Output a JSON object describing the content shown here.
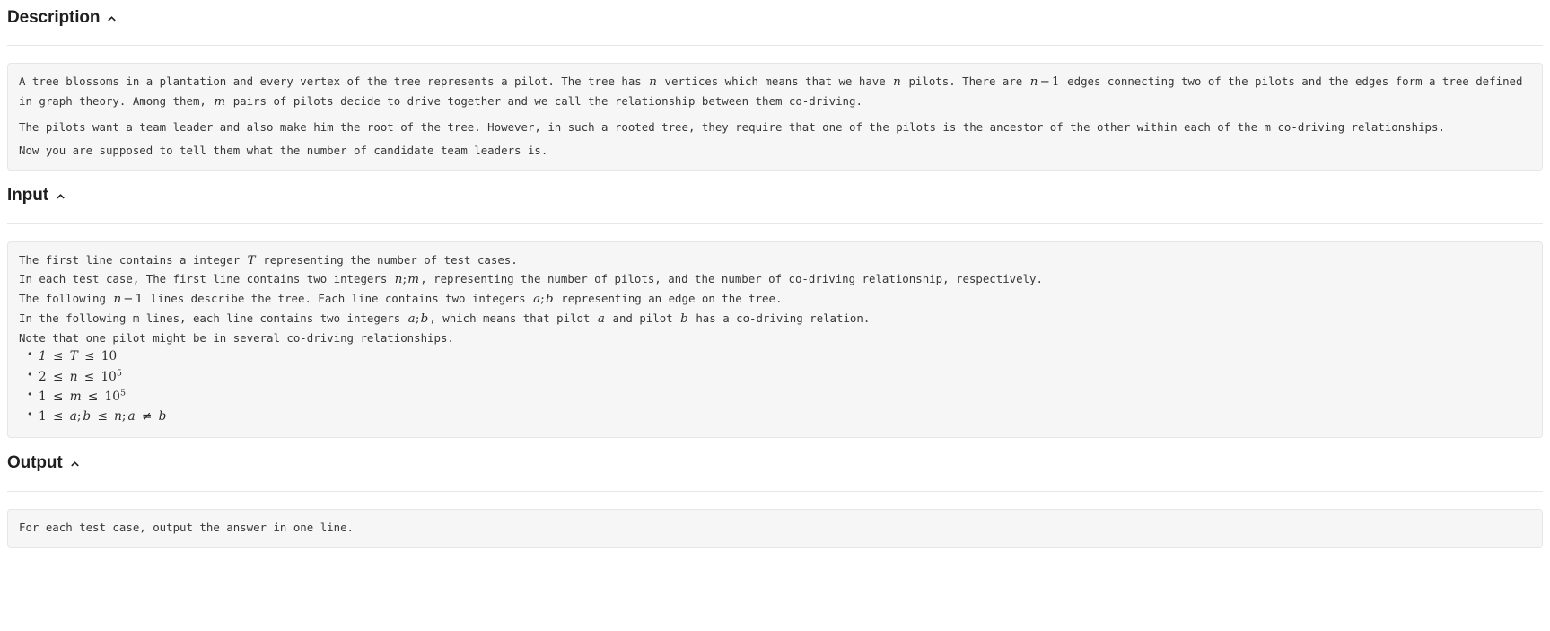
{
  "sections": {
    "description": {
      "title": "Description",
      "toggle_icon": "chevron-up-icon",
      "paragraphs": [
        {
          "runs": [
            {
              "t": "text",
              "v": "A tree blossoms in a plantation and every vertex of the tree represents a pilot. The tree has "
            },
            {
              "t": "math",
              "v": "n"
            },
            {
              "t": "text",
              "v": " vertices which means that we have "
            },
            {
              "t": "math",
              "v": "n"
            },
            {
              "t": "text",
              "v": " pilots. There are "
            },
            {
              "t": "math",
              "v": "n − 1"
            },
            {
              "t": "text",
              "v": " edges connecting two of the pilots and the edges form a tree defined in graph theory. Among them, "
            },
            {
              "t": "math",
              "v": "m"
            },
            {
              "t": "text",
              "v": " pairs of pilots decide to drive together and we call the relationship between them co-driving."
            }
          ]
        },
        {
          "runs": [
            {
              "t": "text",
              "v": "The pilots want a team leader and also make him the root of the tree. However, in such a rooted tree, they require that one of the pilots is the ancestor of the other within each of the m co-driving relationships."
            }
          ]
        },
        {
          "runs": [
            {
              "t": "text",
              "v": "Now you are supposed to tell them what the number of candidate team leaders is."
            }
          ]
        }
      ]
    },
    "input": {
      "title": "Input",
      "toggle_icon": "chevron-up-icon",
      "lines": [
        {
          "runs": [
            {
              "t": "text",
              "v": "The first line contains a integer "
            },
            {
              "t": "math",
              "v": "T"
            },
            {
              "t": "text",
              "v": " representing the number of test cases."
            }
          ]
        },
        {
          "runs": [
            {
              "t": "text",
              "v": "In each test case, The first line contains two integers "
            },
            {
              "t": "math",
              "v": "n;m"
            },
            {
              "t": "text",
              "v": ", representing the number of pilots, and the number of co-driving relationship, respectively."
            }
          ]
        },
        {
          "runs": [
            {
              "t": "text",
              "v": "The following "
            },
            {
              "t": "math",
              "v": "n − 1"
            },
            {
              "t": "text",
              "v": " lines describe the tree. Each line contains two integers "
            },
            {
              "t": "math",
              "v": "a;b"
            },
            {
              "t": "text",
              "v": " representing an edge on the tree."
            }
          ]
        },
        {
          "runs": [
            {
              "t": "text",
              "v": "In the following m lines, each line contains two integers "
            },
            {
              "t": "math",
              "v": "a;b"
            },
            {
              "t": "text",
              "v": ", which means that pilot "
            },
            {
              "t": "math",
              "v": "a"
            },
            {
              "t": "text",
              "v": " and pilot "
            },
            {
              "t": "math",
              "v": "b"
            },
            {
              "t": "text",
              "v": " has a co-driving relation."
            }
          ]
        },
        {
          "runs": [
            {
              "t": "text",
              "v": "Note that one pilot might be in several co-driving relationships."
            }
          ]
        }
      ],
      "constraints": [
        {
          "html": "1 <span class=\"op\">≤</span> T <span class=\"op\">≤</span> <span class=\"num\">10</span>",
          "text": "1 ≤ T ≤ 10"
        },
        {
          "html": "<span class=\"num\">2</span> <span class=\"op\">≤</span> n <span class=\"op\">≤</span> <span class=\"num\">10</span><sup>5</sup>",
          "text": "2 ≤ n ≤ 10^5"
        },
        {
          "html": "<span class=\"num\">1</span> <span class=\"op\">≤</span> m <span class=\"op\">≤</span> <span class=\"num\">10</span><sup>5</sup>",
          "text": "1 ≤ m ≤ 10^5"
        },
        {
          "html": "<span class=\"num\">1</span> <span class=\"op\">≤</span> a<span class=\"semi\">;</span>b <span class=\"op\">≤</span> n<span class=\"semi\">;</span>a <span class=\"op\">≠</span> b",
          "text": "1 ≤ a;b ≤ n;a ≠ b"
        }
      ]
    },
    "output": {
      "title": "Output",
      "toggle_icon": "chevron-up-icon",
      "lines": [
        {
          "runs": [
            {
              "t": "text",
              "v": "For each test case, output the answer in one line."
            }
          ]
        }
      ]
    }
  },
  "colors": {
    "page_background": "#ffffff",
    "panel_background": "#f6f6f6",
    "panel_border": "#e6e6e6",
    "heading_text": "#1f1f1f",
    "body_text": "#373737",
    "rule": "#e7e7e7"
  }
}
